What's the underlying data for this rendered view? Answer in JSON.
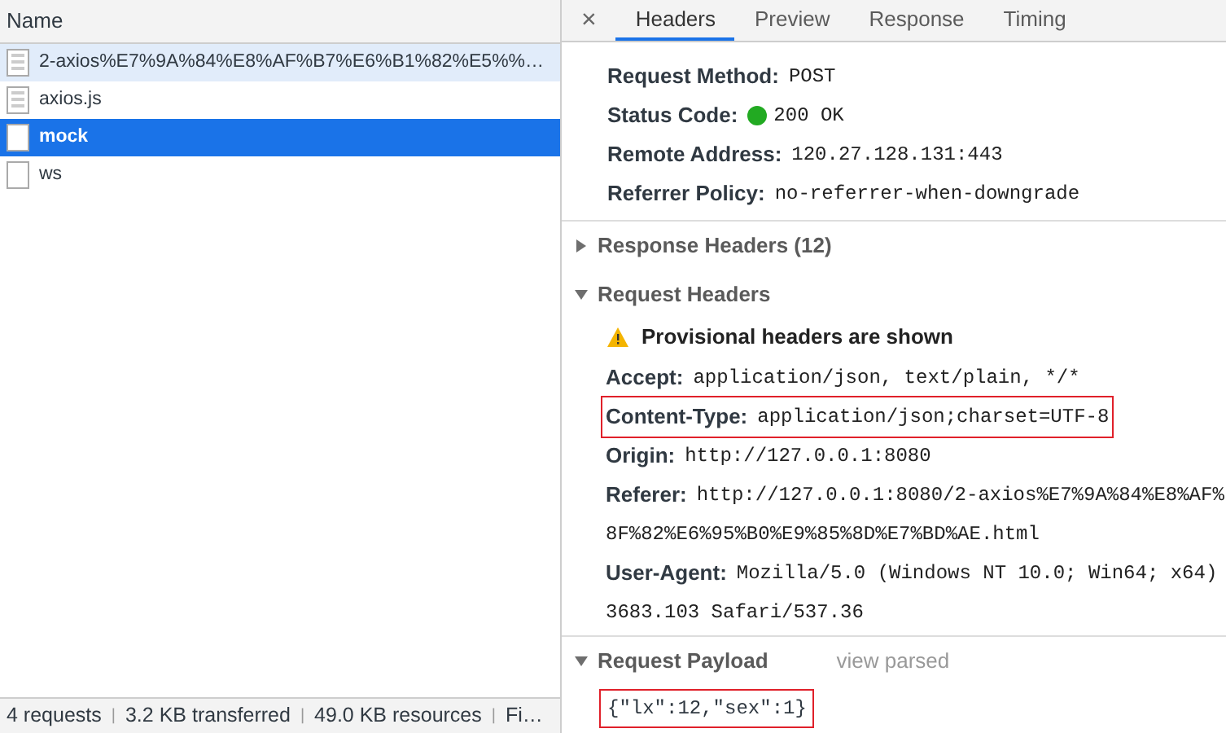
{
  "requests_panel": {
    "column": "Name",
    "rows": [
      {
        "name": "2-axios%E7%9A%84%E8%AF%B7%E6%B1%82%E5%%…",
        "kind": "document",
        "selected": false,
        "hovered": true
      },
      {
        "name": "axios.js",
        "kind": "document",
        "selected": false,
        "hovered": false
      },
      {
        "name": "mock",
        "kind": "blank",
        "selected": true,
        "hovered": false
      },
      {
        "name": "ws",
        "kind": "blank",
        "selected": false,
        "hovered": false
      }
    ],
    "status_bar": [
      "4 requests",
      "3.2 KB transferred",
      "49.0 KB resources",
      "Fi…"
    ],
    "status_separator": "|"
  },
  "details": {
    "close": "×",
    "tabs": [
      {
        "label": "Headers",
        "selected": true
      },
      {
        "label": "Preview",
        "selected": false
      },
      {
        "label": "Response",
        "selected": false
      },
      {
        "label": "Timing",
        "selected": false
      }
    ],
    "general": [
      {
        "name": "Request Method:",
        "value": [
          "POST"
        ]
      },
      {
        "name": "Status Code:",
        "value": [
          "200 OK"
        ],
        "color": "#22aa22"
      },
      {
        "name": "Remote Address:",
        "value": [
          "120.27.128.131:443"
        ]
      },
      {
        "name": "Referrer Policy:",
        "value": [
          "no-referrer-when-downgrade"
        ]
      }
    ],
    "sections": [
      {
        "title": "Response Headers (12)",
        "expanded": false
      },
      {
        "title": "Request Headers",
        "expanded": true,
        "warning": "Provisional headers are shown",
        "headers": [
          {
            "name": "Accept:",
            "value": [
              "application/json, text/plain, */*"
            ],
            "highlighted": false
          },
          {
            "name": "Content-Type:",
            "value": [
              "application/json;charset=UTF-8"
            ],
            "highlighted": true
          },
          {
            "name": "Origin:",
            "value": [
              "http://127.0.0.1:8080"
            ],
            "highlighted": false
          },
          {
            "name": "Referer:",
            "value": [
              "http://127.0.0.1:8080/2-axios%E7%9A%84%E8%AF%",
              "8F%82%E6%95%B0%E9%85%8D%E7%BD%AE.html"
            ],
            "highlighted": false
          },
          {
            "name": "User-Agent:",
            "value": [
              "Mozilla/5.0 (Windows NT 10.0; Win64; x64)",
              "3683.103 Safari/537.36"
            ],
            "highlighted": false
          }
        ]
      },
      {
        "title": "Request Payload",
        "expanded": true,
        "link": "view parsed",
        "payload": "{\"lx\":12,\"sex\":1}",
        "payload_highlighted": true
      }
    ]
  }
}
